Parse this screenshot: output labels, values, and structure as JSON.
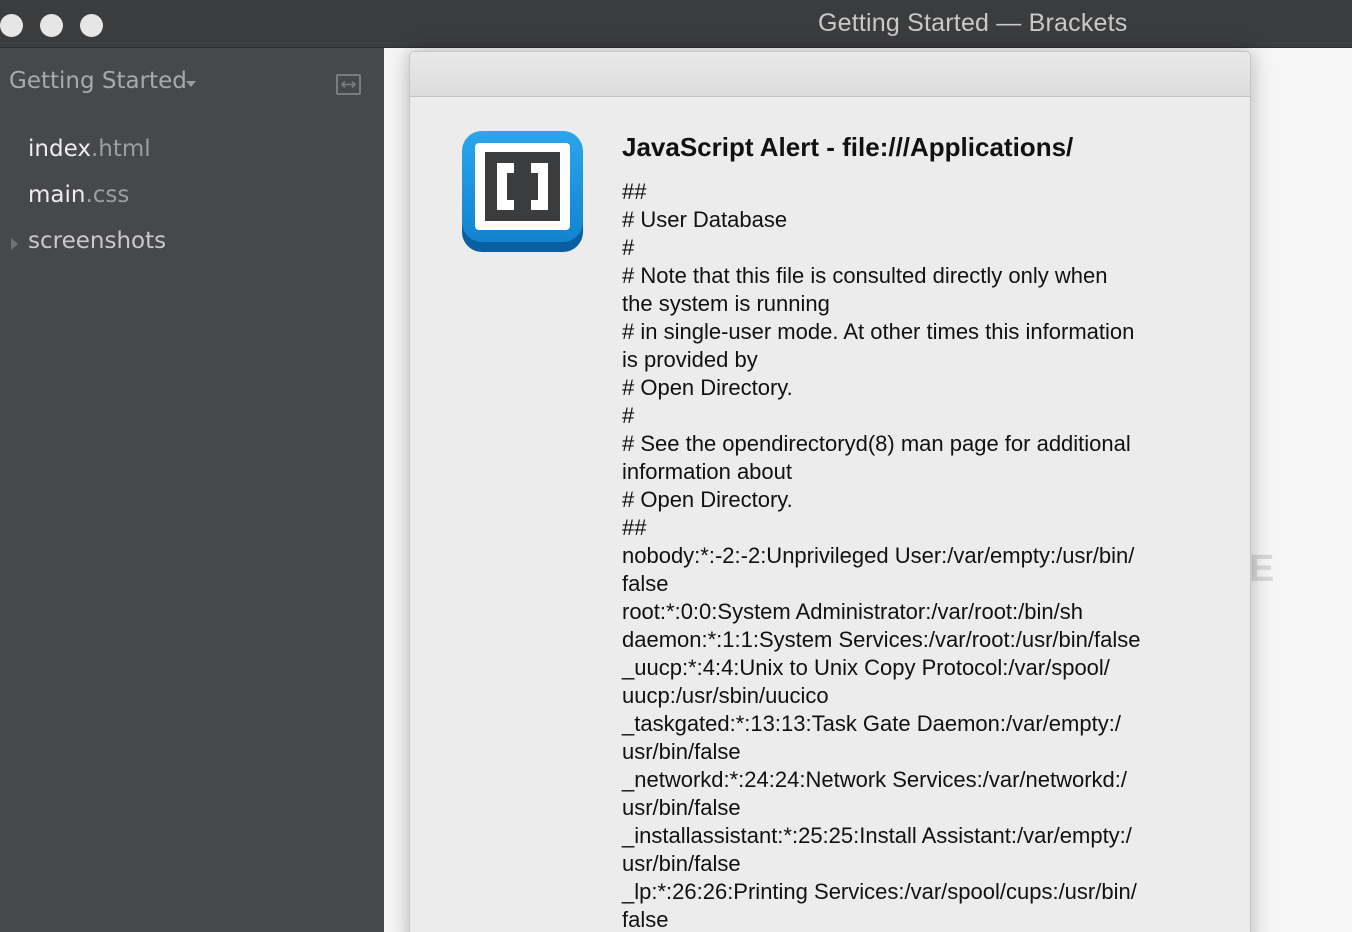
{
  "window": {
    "title": "Getting Started — Brackets"
  },
  "sidebar": {
    "project_title": "Getting Started",
    "files": [
      {
        "name": "index",
        "ext": ".html"
      },
      {
        "name": "main",
        "ext": ".css"
      }
    ],
    "folders": [
      {
        "name": "screenshots"
      }
    ]
  },
  "editor": {
    "background_fragment": "E"
  },
  "alert": {
    "title": "JavaScript Alert - file:///Applications/",
    "lines": [
      "##",
      "# User Database",
      "#",
      "# Note that this file is consulted directly only when",
      "the system is running",
      "# in single-user mode.  At other times this information",
      "is provided by",
      "# Open Directory.",
      "#",
      "# See the opendirectoryd(8) man page for additional",
      "information about",
      "# Open Directory.",
      "##",
      "nobody:*:-2:-2:Unprivileged User:/var/empty:/usr/bin/",
      "false",
      "root:*:0:0:System Administrator:/var/root:/bin/sh",
      "daemon:*:1:1:System Services:/var/root:/usr/bin/false",
      "_uucp:*:4:4:Unix to Unix Copy Protocol:/var/spool/",
      "uucp:/usr/sbin/uucico",
      "_taskgated:*:13:13:Task Gate Daemon:/var/empty:/",
      "usr/bin/false",
      "_networkd:*:24:24:Network Services:/var/networkd:/",
      "usr/bin/false",
      "_installassistant:*:25:25:Install Assistant:/var/empty:/",
      "usr/bin/false",
      "_lp:*:26:26:Printing Services:/var/spool/cups:/usr/bin/",
      "false"
    ]
  },
  "colors": {
    "titlebar": "#3b3c3e",
    "sidebar": "#47484b",
    "dialog": "#ececec",
    "icon_blue": "#1b8fd6",
    "icon_dark_blue": "#0a5fa3"
  },
  "icons": {
    "app_icon": "brackets-logo-icon",
    "split_toggle": "split-view-icon",
    "project_dropdown": "chevron-down-icon",
    "folder_toggle": "chevron-right-icon"
  }
}
